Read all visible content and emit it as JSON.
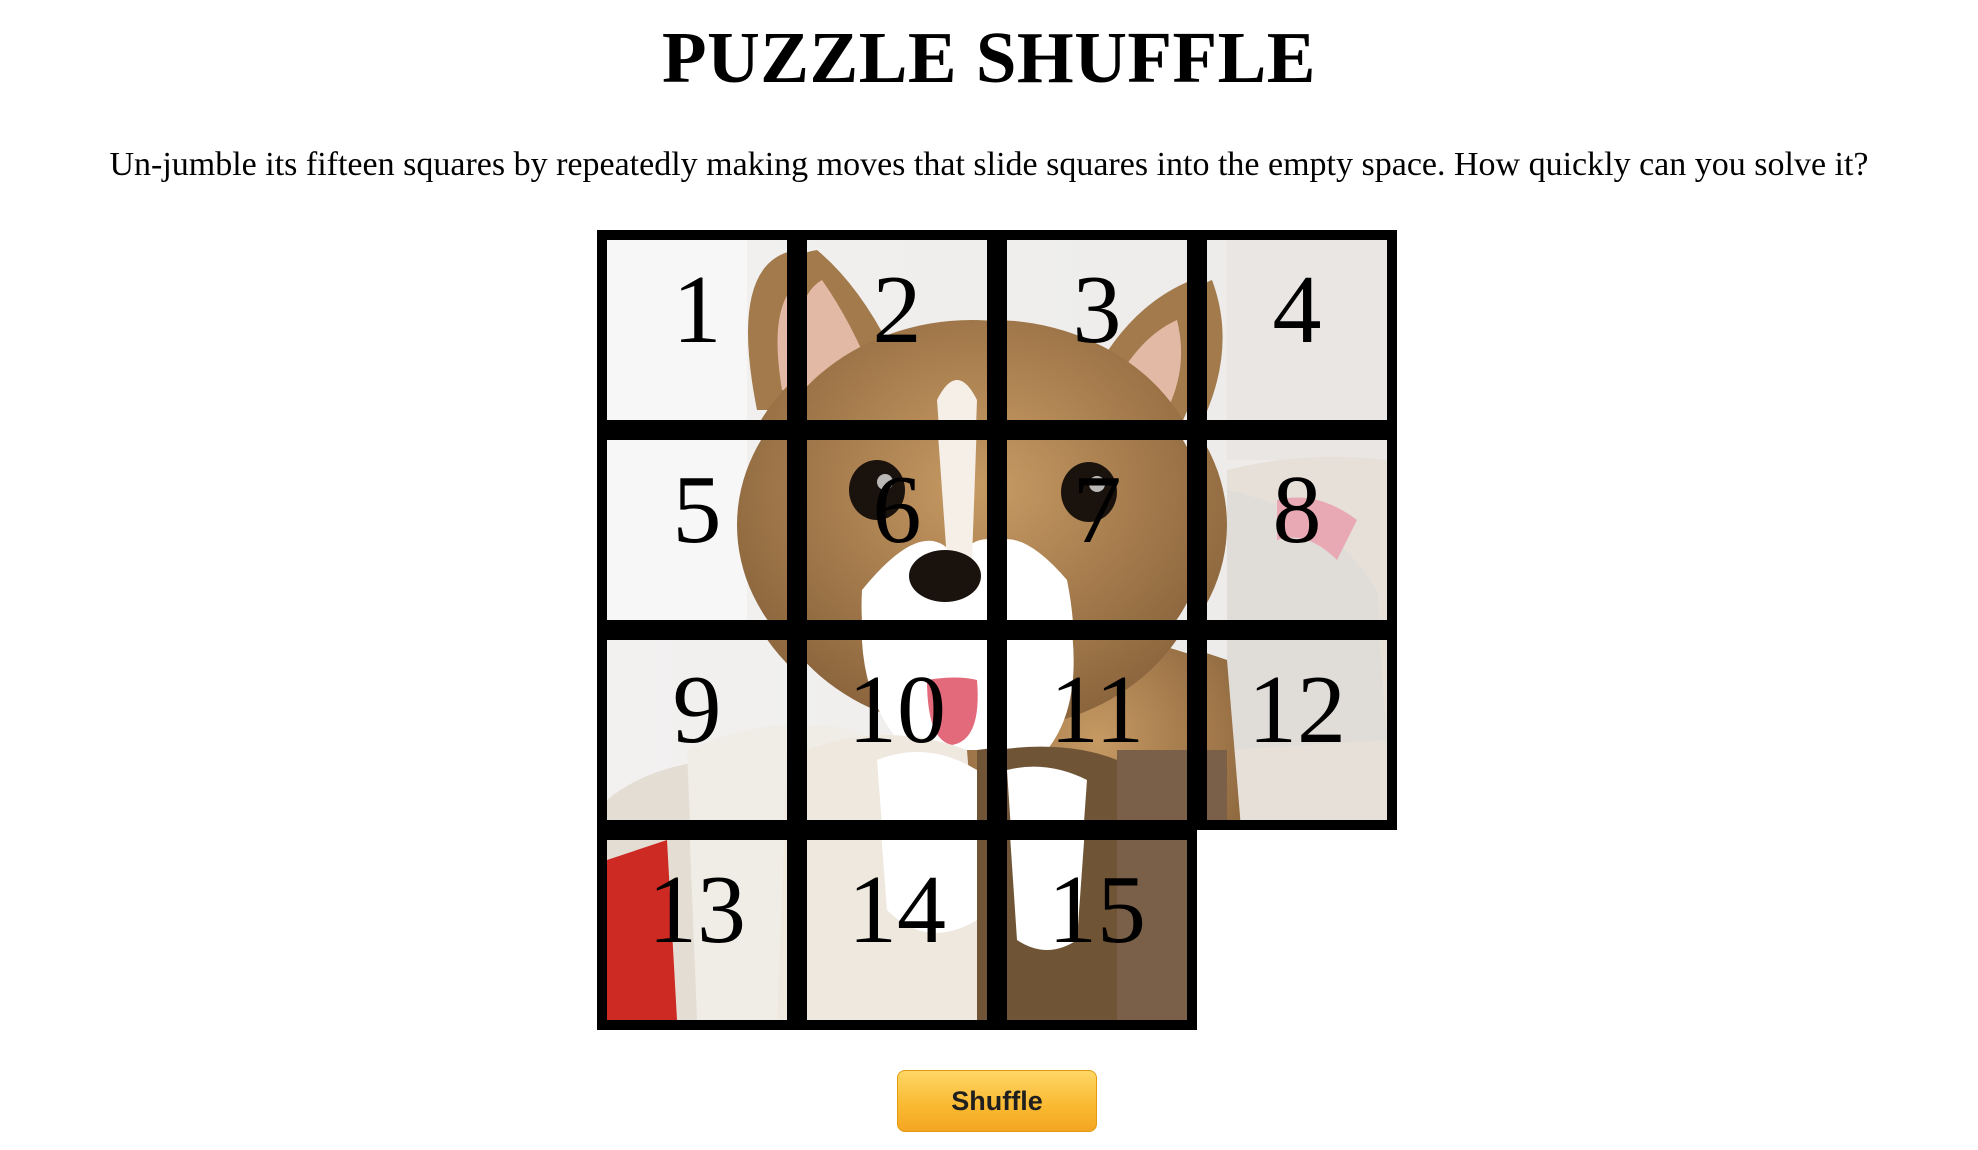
{
  "page": {
    "title": "PUZZLE SHUFFLE",
    "instructions": "Un-jumble its fifteen squares by repeatedly making moves that slide squares into the empty space. How quickly can you solve it?"
  },
  "puzzle": {
    "grid_size": 4,
    "tiles": [
      {
        "number": "1",
        "row": 0,
        "col": 0
      },
      {
        "number": "2",
        "row": 0,
        "col": 1
      },
      {
        "number": "3",
        "row": 0,
        "col": 2
      },
      {
        "number": "4",
        "row": 0,
        "col": 3
      },
      {
        "number": "5",
        "row": 1,
        "col": 0
      },
      {
        "number": "6",
        "row": 1,
        "col": 1
      },
      {
        "number": "7",
        "row": 1,
        "col": 2
      },
      {
        "number": "8",
        "row": 1,
        "col": 3
      },
      {
        "number": "9",
        "row": 2,
        "col": 0
      },
      {
        "number": "10",
        "row": 2,
        "col": 1
      },
      {
        "number": "11",
        "row": 2,
        "col": 2
      },
      {
        "number": "12",
        "row": 2,
        "col": 3
      },
      {
        "number": "13",
        "row": 3,
        "col": 0
      },
      {
        "number": "14",
        "row": 3,
        "col": 1
      },
      {
        "number": "15",
        "row": 3,
        "col": 2
      }
    ],
    "empty": {
      "row": 3,
      "col": 3
    },
    "image_subject": "corgi puppy photo"
  },
  "controls": {
    "shuffle_label": "Shuffle"
  },
  "colors": {
    "tile_border": "#000000",
    "button_top": "#ffd766",
    "button_bottom": "#f4a622"
  }
}
